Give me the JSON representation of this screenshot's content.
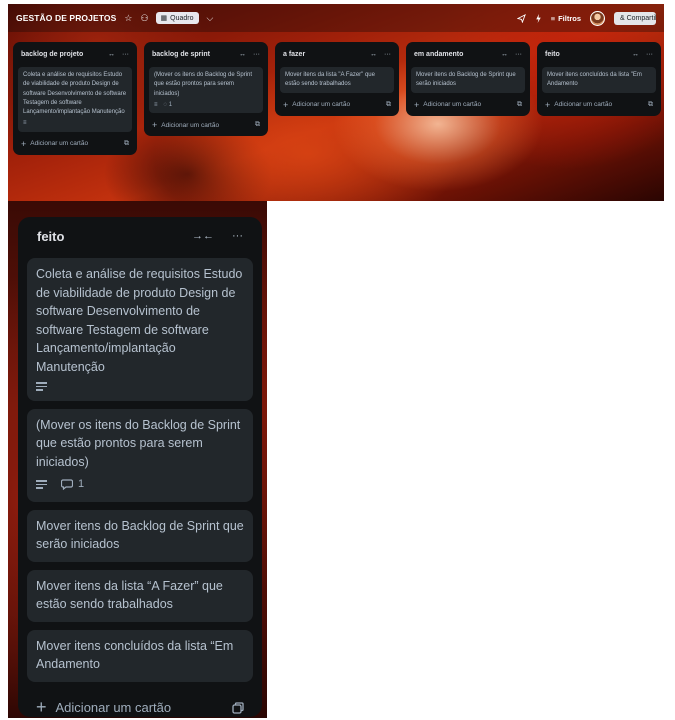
{
  "board": {
    "title": "GESTÃO DE PROJETOS",
    "star_glyph": "☆",
    "people_glyph": "⚇",
    "view_icon": "▦",
    "view_label": "Quadro",
    "view_chevron": "⌵",
    "filter_icon": "≡",
    "filter_label": "Filtros",
    "share_label": "& Compartilhar",
    "lists": [
      {
        "title": "backlog de projeto",
        "cards": [
          {
            "text": "Coleta e análise de requisitos Estudo de viabilidade de produto Design de software Desenvolvimento de software Testagem de software Lançamento/implantação Manutenção",
            "has_description": true,
            "comments": ""
          }
        ],
        "add_label": "Adicionar um cartão"
      },
      {
        "title": "backlog de sprint",
        "cards": [
          {
            "text": "(Mover os itens do Backlog de Sprint que estão prontos para serem iniciados)",
            "has_description": true,
            "comments": "1"
          }
        ],
        "add_label": "Adicionar um cartão"
      },
      {
        "title": "a fazer",
        "cards": [
          {
            "text": "Mover itens da lista \"A Fazer\" que estão sendo trabalhados",
            "has_description": false,
            "comments": ""
          }
        ],
        "add_label": "Adicionar um cartão"
      },
      {
        "title": "em andamento",
        "cards": [
          {
            "text": "Mover itens do Backlog de Sprint que serão iniciados",
            "has_description": false,
            "comments": ""
          }
        ],
        "add_label": "Adicionar um cartão"
      },
      {
        "title": "feito",
        "cards": [
          {
            "text": "Mover itens concluídos da lista \"Em Andamento",
            "has_description": false,
            "comments": ""
          }
        ],
        "add_label": "Adicionar um cartão"
      }
    ]
  },
  "zoomed_list": {
    "title": "feito",
    "collapse_glyph": "→←",
    "menu_glyph": "···",
    "cards": [
      {
        "text": "Coleta e análise de requisitos Estudo de viabilidade de produto Design de software Desenvolvimento de software Testagem de software Lançamento/implantação Manutenção",
        "has_description": true,
        "comments": ""
      },
      {
        "text": "(Mover os itens do Backlog de Sprint que estão prontos para serem iniciados)",
        "has_description": true,
        "comments": "1"
      },
      {
        "text": "Mover itens do Backlog de Sprint que serão iniciados",
        "has_description": false,
        "comments": ""
      },
      {
        "text": "Mover itens da lista “A Fazer” que estão sendo trabalhados",
        "has_description": false,
        "comments": ""
      },
      {
        "text": "Mover itens concluídos da lista “Em Andamento",
        "has_description": false,
        "comments": ""
      }
    ],
    "add_label": "Adicionar um cartão"
  },
  "colors": {
    "list_bg": "#101214",
    "card_bg": "#22272b",
    "card_text": "#b6c2cf"
  }
}
